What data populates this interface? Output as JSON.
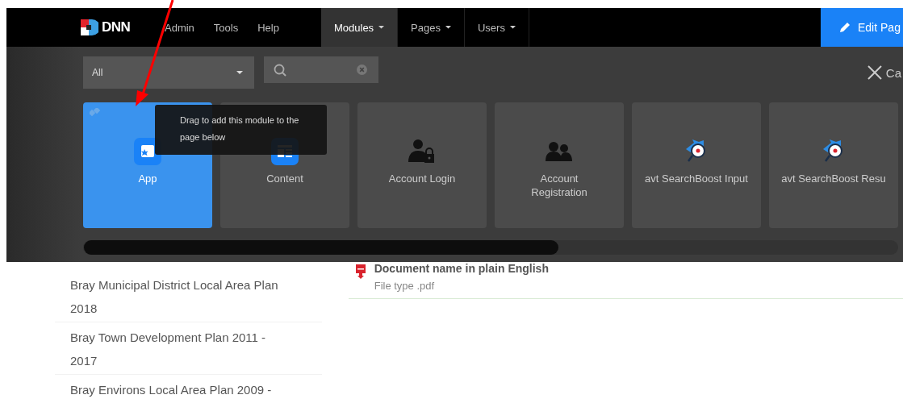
{
  "nav": {
    "logo": "DNN",
    "items": [
      {
        "label": "Admin",
        "dropdown": false,
        "selected": false
      },
      {
        "label": "Tools",
        "dropdown": false,
        "selected": false
      },
      {
        "label": "Help",
        "dropdown": false,
        "selected": false
      },
      {
        "label": "Modules",
        "dropdown": true,
        "selected": true
      },
      {
        "label": "Pages",
        "dropdown": true,
        "selected": false
      },
      {
        "label": "Users",
        "dropdown": true,
        "selected": false
      }
    ],
    "edit_button": "Edit Pag"
  },
  "module_panel": {
    "filter": {
      "value": "All"
    },
    "cancel": "Ca",
    "tooltip": "Drag to add this module to the page below",
    "modules": [
      {
        "name": "App",
        "kind": "app",
        "selected": true
      },
      {
        "name": "Content",
        "kind": "content",
        "selected": false
      },
      {
        "name": "Account Login",
        "kind": "login",
        "selected": false
      },
      {
        "name": "Account Registration",
        "kind": "users",
        "selected": false
      },
      {
        "name": "avt SearchBoost Input",
        "kind": "searchboost",
        "selected": false
      },
      {
        "name": "avt SearchBoost Resu",
        "kind": "searchboost",
        "selected": false
      }
    ]
  },
  "sidebar": {
    "items": [
      {
        "label": "Bray Municipal District Local Area Plan 2018"
      },
      {
        "label": "Bray Town Development Plan 2011 - 2017"
      },
      {
        "label": "Bray Environs Local Area Plan 2009 -"
      }
    ]
  },
  "document": {
    "name": "Document name in plain English",
    "type": "File type .pdf"
  }
}
